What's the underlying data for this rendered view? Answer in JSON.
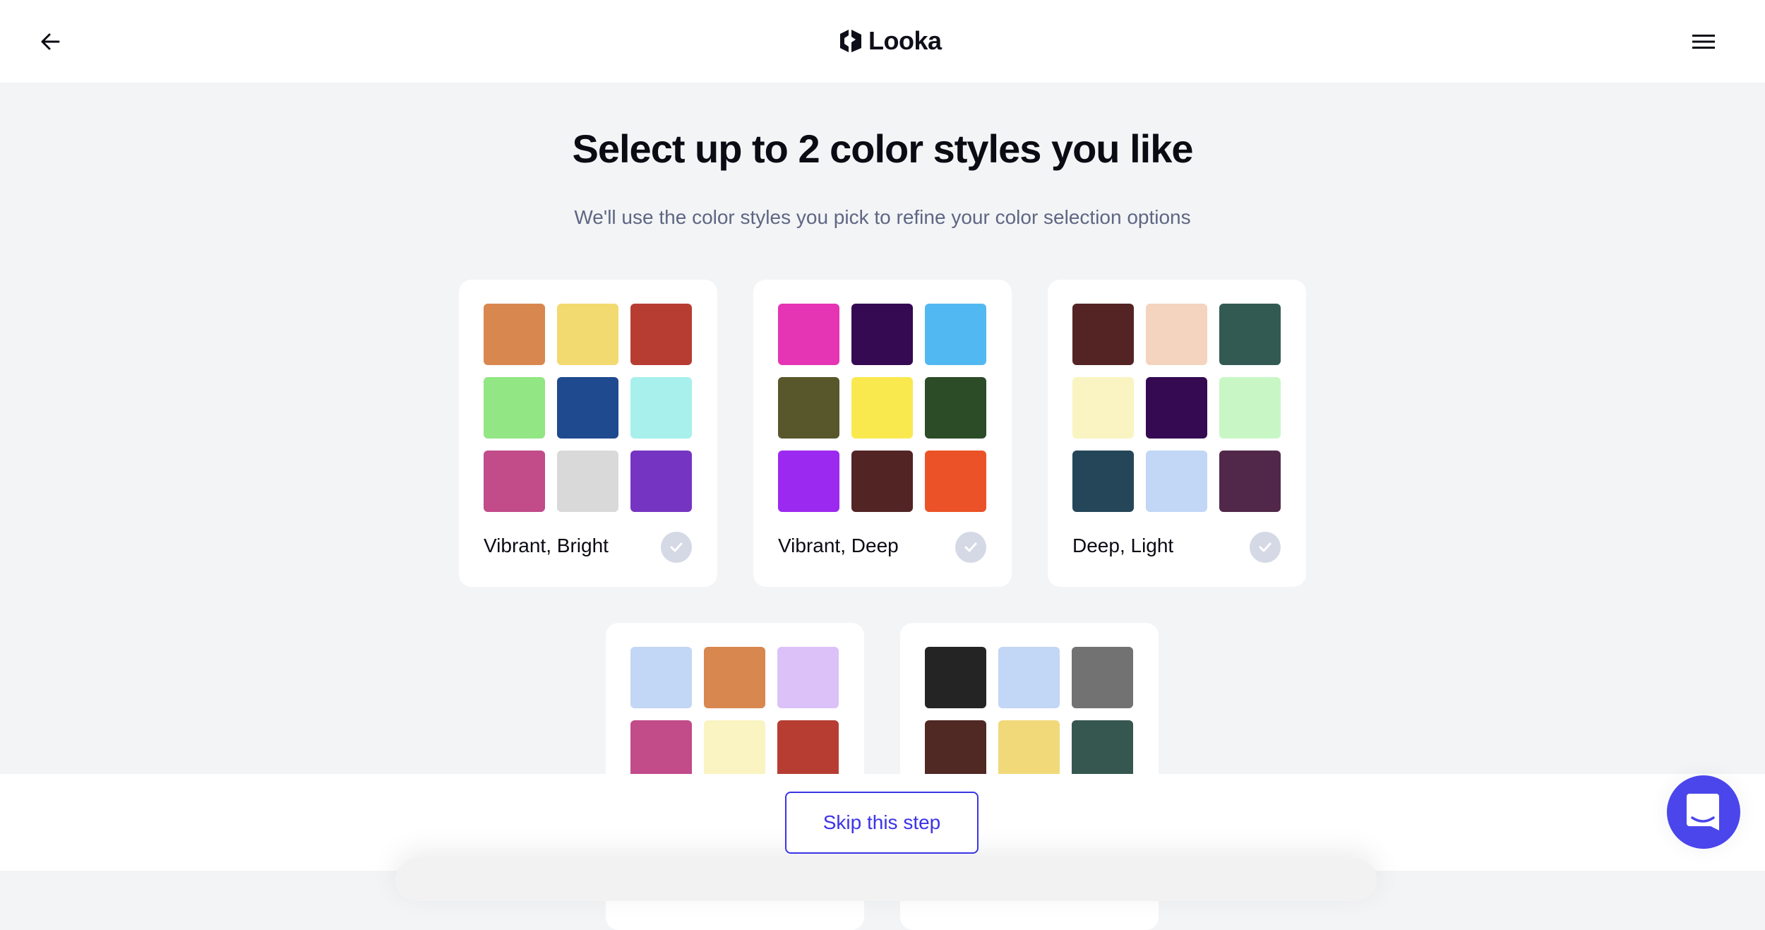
{
  "header": {
    "back_icon": "arrow-left-icon",
    "logo_icon": "looka-hexagon-logo-icon",
    "logo_text": "Looka",
    "menu_icon": "hamburger-menu-icon"
  },
  "main": {
    "title": "Select up to 2 color styles you like",
    "subtitle": "We'll use the color styles you pick to refine your color selection options",
    "styles": [
      {
        "label": "Vibrant, Bright",
        "selected": false,
        "colors": [
          "#d8874f",
          "#f2da70",
          "#b73d33",
          "#92e683",
          "#1f4a8f",
          "#a7f0ec",
          "#c24b8a",
          "#d9d9d9",
          "#7535c2"
        ]
      },
      {
        "label": "Vibrant, Deep",
        "selected": false,
        "colors": [
          "#e535b4",
          "#350a52",
          "#52b8f2",
          "#58572b",
          "#f9e94f",
          "#2c4b27",
          "#9c29f0",
          "#532424",
          "#ec5227"
        ]
      },
      {
        "label": "Deep, Light",
        "selected": false,
        "colors": [
          "#542424",
          "#f4d3bf",
          "#325a52",
          "#f9f4c1",
          "#350a52",
          "#c8f7c5",
          "#244658",
          "#c2d6f5",
          "#52284a"
        ]
      },
      {
        "label": "",
        "selected": false,
        "colors": [
          "#c2d6f5",
          "#d8874f",
          "#dbc1f8",
          "#c24b8a",
          "#f9f4c1",
          "#b73d33"
        ]
      },
      {
        "label": "",
        "selected": false,
        "colors": [
          "#242424",
          "#c2d6f5",
          "#727272",
          "#502824",
          "#f1d97a",
          "#365750"
        ]
      }
    ]
  },
  "footer": {
    "skip_label": "Skip this step",
    "chat_icon": "chat-bubble-smile-icon"
  },
  "colors": {
    "accent": "#3b34e6",
    "chat_button": "#4a46ec",
    "page_background": "#f3f4f6",
    "check_inactive": "#d5d9e6",
    "subtitle_text": "#5e6683"
  }
}
